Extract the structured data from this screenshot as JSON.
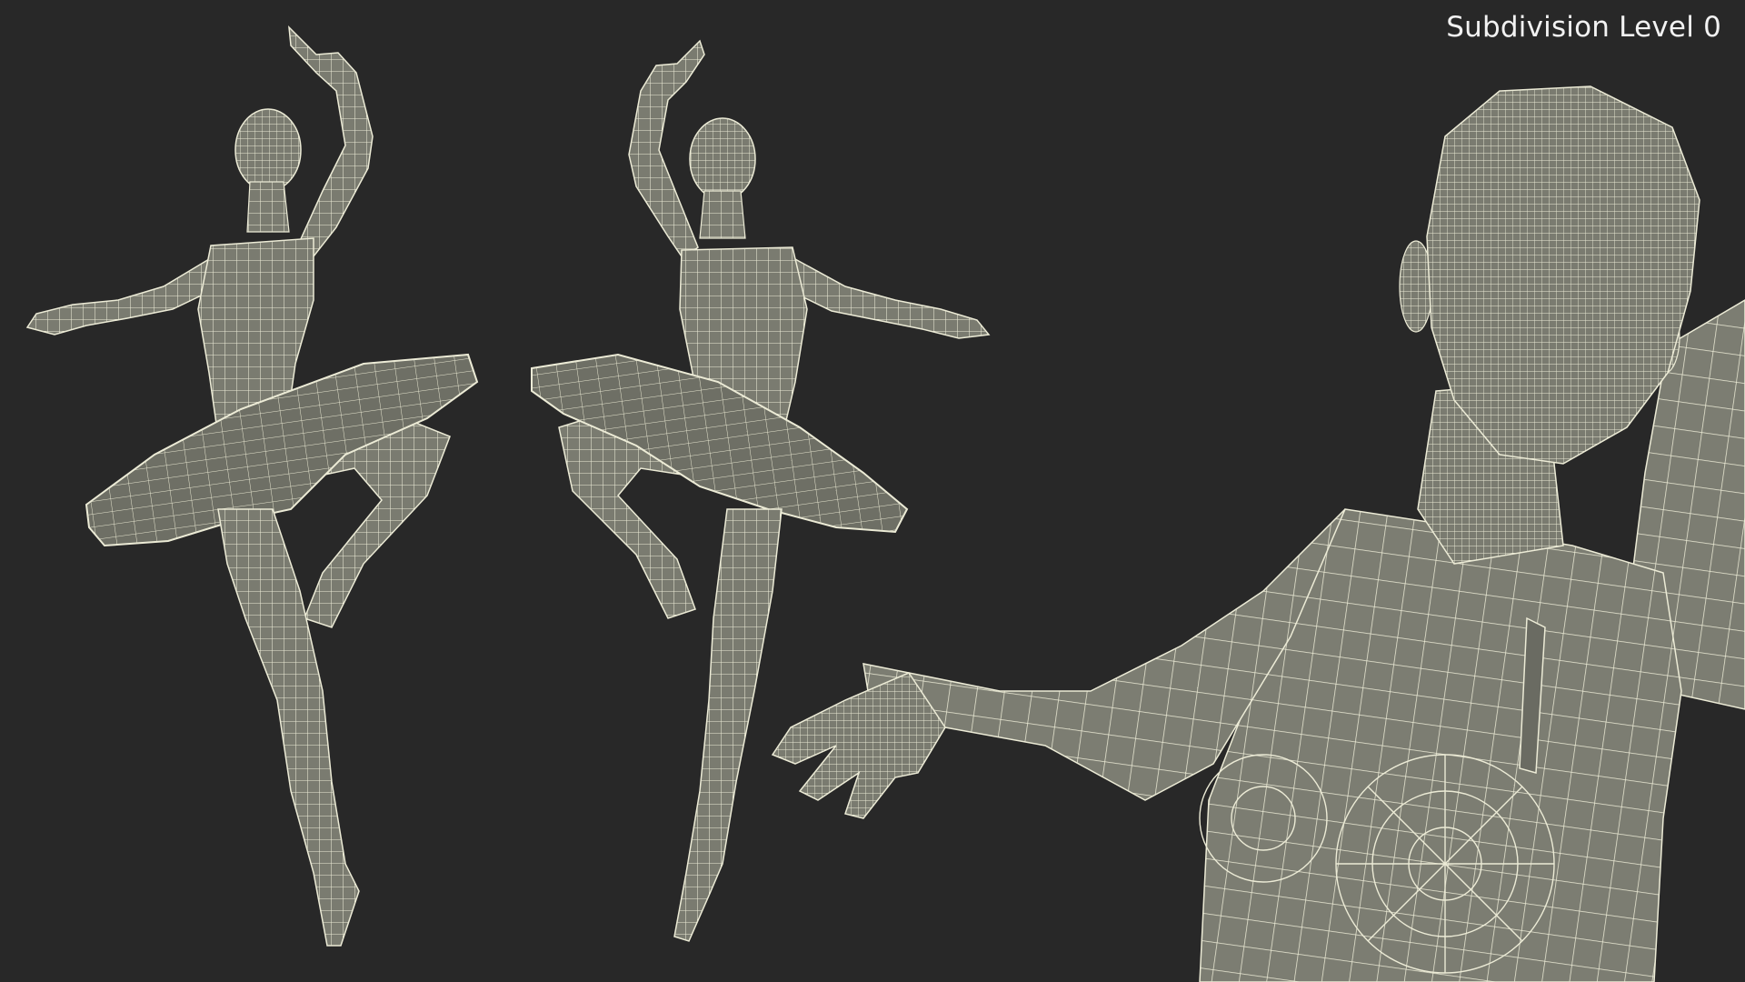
{
  "overlay": {
    "label": "Subdivision Level 0"
  },
  "colors": {
    "background": "#282828",
    "mesh_surface": "#7a7b70",
    "mesh_shadow": "#5f6057",
    "wire": "#ecebd6"
  },
  "views": [
    {
      "name": "front-view"
    },
    {
      "name": "back-view"
    },
    {
      "name": "closeup-view"
    }
  ]
}
